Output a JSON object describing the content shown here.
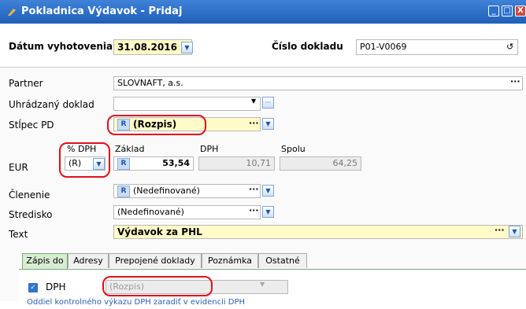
{
  "window": {
    "title": "Pokladnica Výdavok - Pridaj",
    "buttons": [
      "_",
      "□",
      "X"
    ]
  },
  "header": {
    "date_label": "Dátum vyhotovenia",
    "date_value": "31.08.2016",
    "doc_number_label": "Číslo dokladu",
    "doc_number_value": "P01-V0069"
  },
  "form": {
    "partner": {
      "label": "Partner",
      "value": "SLOVNAFT, a.s."
    },
    "paid_doc": {
      "label": "Uhrádzaný doklad",
      "value": ""
    },
    "column_pd": {
      "label": "Stĺpec PD",
      "badge": "R",
      "value": "(Rozpis)"
    },
    "amounts": {
      "currency_label": "EUR",
      "vat_pct_label": "% DPH",
      "vat_pct_value": "(R)",
      "base_label": "Základ",
      "base_badge": "R",
      "base_value": "53,54",
      "vat_label": "DPH",
      "vat_value": "10,71",
      "total_label": "Spolu",
      "total_value": "64,25"
    },
    "division": {
      "label": "Členenie",
      "badge": "R",
      "value": "(Nedefinované)"
    },
    "center": {
      "label": "Stredisko",
      "value": "(Nedefinované)"
    },
    "text": {
      "label": "Text",
      "value": "Výdavok za PHL"
    }
  },
  "tabs": [
    {
      "label": "Zápis do",
      "active": true
    },
    {
      "label": "Adresy",
      "active": false
    },
    {
      "label": "Prepojené doklady",
      "active": false
    },
    {
      "label": "Poznámka",
      "active": false
    },
    {
      "label": "Ostatné",
      "active": false
    }
  ],
  "tab_content": {
    "dph_label": "DPH",
    "dph_checked": true,
    "dph_value": "(Rozpis)",
    "note": "Oddiel kontrolného výkazu DPH zaradiť v evidencii DPH"
  },
  "colors": {
    "title_bar": "#1f5fb8",
    "highlight_field": "#fffbc8",
    "annotation": "#e0101a",
    "active_tab": "#d7ecd3"
  }
}
